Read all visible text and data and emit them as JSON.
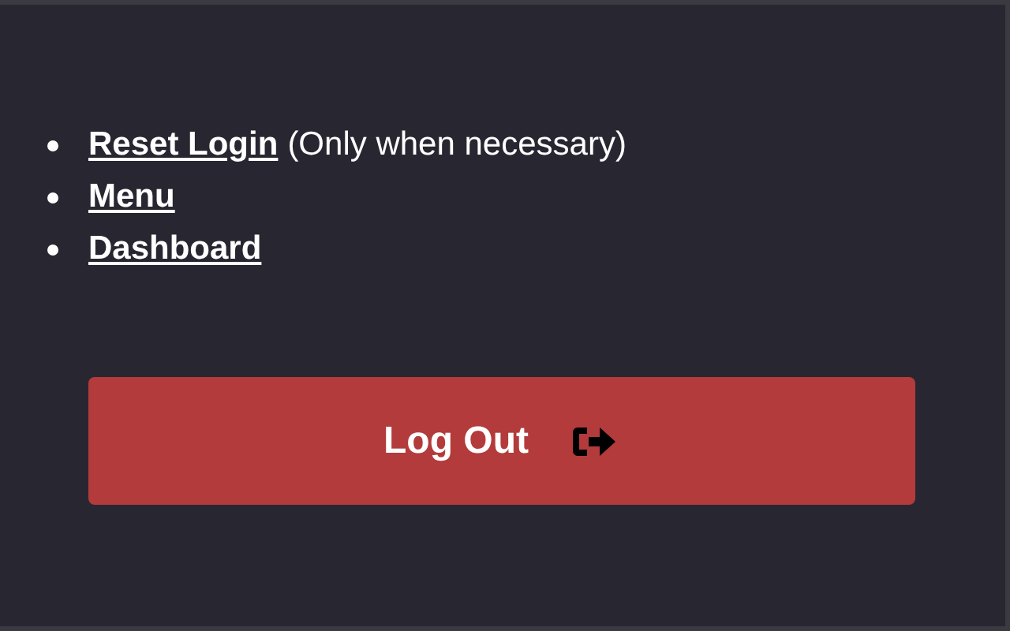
{
  "links": [
    {
      "label": "Reset Login",
      "note": "(Only when necessary)"
    },
    {
      "label": "Menu"
    },
    {
      "label": "Dashboard"
    }
  ],
  "logout_button": {
    "label": "Log Out"
  }
}
